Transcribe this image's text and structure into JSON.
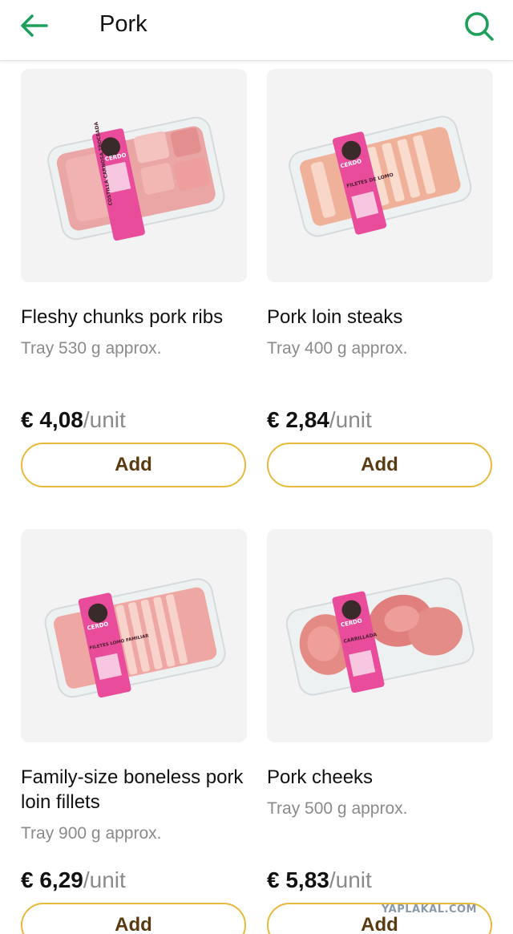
{
  "header": {
    "title": "Pork",
    "accent_color": "#1e9f5a"
  },
  "products": [
    {
      "name": "Fleshy chunks pork ribs",
      "weight": "Tray 530 g approx.",
      "price": "€ 4,08",
      "unit": "/unit",
      "add_label": "Add",
      "label_text": "COSTILLA CARNOSA TROCEADA"
    },
    {
      "name": "Pork loin steaks",
      "weight": "Tray 400 g approx.",
      "price": "€ 2,84",
      "unit": "/unit",
      "add_label": "Add",
      "label_text": "FILETES DE LOMO"
    },
    {
      "name": "Family-size boneless pork loin fillets",
      "weight": "Tray 900 g approx.",
      "price": "€ 6,29",
      "unit": "/unit",
      "add_label": "Add",
      "label_text": "FILETES LOMO FAMILIAR"
    },
    {
      "name": "Pork cheeks",
      "weight": "Tray 500 g approx.",
      "price": "€ 5,83",
      "unit": "/unit",
      "add_label": "Add",
      "label_text": "CARRILLADA"
    }
  ],
  "brand_label": "CERDO",
  "button_border_color": "#e8b93a",
  "watermark": "YAPLAKAL.COM"
}
